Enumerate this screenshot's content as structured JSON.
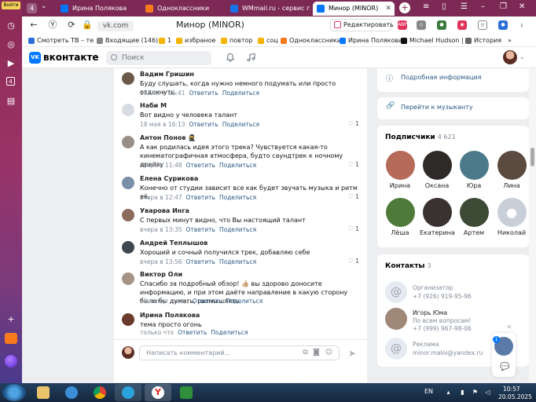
{
  "browser": {
    "login_label": "Войти",
    "tab_count": "4",
    "tabs": [
      {
        "title": "Ирина Полякова",
        "fav_color": "#0077ff"
      },
      {
        "title": "Одноклассники",
        "fav_color": "#f97a1c"
      },
      {
        "title": "WMmail.ru - сервис по",
        "fav_color": "#1a73e8"
      },
      {
        "title": "Минор (MINOR)",
        "fav_color": "#0077ff"
      }
    ],
    "url_host": "vk.com",
    "page_title": "Минор (MINOR)",
    "edit_button": "Редактировать",
    "bookmarks": [
      {
        "label": "Смотреть ТВ – те",
        "color": "#2b6fd6"
      },
      {
        "label": "Входящие (146) –",
        "color": "#888888"
      },
      {
        "label": "1",
        "color": "#f4b400"
      },
      {
        "label": "избраное",
        "color": "#f4b400"
      },
      {
        "label": "повтор",
        "color": "#f4b400"
      },
      {
        "label": "соц",
        "color": "#f4b400"
      },
      {
        "label": "Одноклассники",
        "color": "#f97a1c"
      },
      {
        "label": "Ирина Полякова",
        "color": "#0077ff"
      },
      {
        "label": "Michael Hudson |",
        "color": "#111111"
      },
      {
        "label": "История",
        "color": "#666666"
      }
    ]
  },
  "vk": {
    "logo": "вконтакте",
    "search_placeholder": "Поиск"
  },
  "comments": [
    {
      "name": "Вадим Гришин",
      "text": "Буду слушать, когда нужно немного подумать или просто отдохнуть.",
      "time": "18 мая в 12:41",
      "likes": "",
      "avatar": "#6b5a4a"
    },
    {
      "name": "Наби М",
      "text": "Вот видно у человека талант",
      "time": "18 мая в 16:13",
      "likes": "1",
      "avatar": "#d7dce2"
    },
    {
      "name": "Антон Понов 🥷",
      "text": "А как родилась идея этого трека? Чувствуется какая-то кинематографичная атмосфера, будто саундтрек к ночному драйву",
      "time": "вчера в 11:48",
      "likes": "1",
      "avatar": "#9a8f86"
    },
    {
      "name": "Елена Сурикова",
      "text": "Конечно от студии зависит все как будет звучать музыка и ритм её.",
      "time": "вчера в 12:47",
      "likes": "1",
      "avatar": "#7a8fa8"
    },
    {
      "name": "Уварова Инга",
      "text": "С первых минут видно, что Вы настоящий талант",
      "time": "вчера в 13:35",
      "likes": "1",
      "avatar": "#8c6a5c"
    },
    {
      "name": "Андрей Теплышов",
      "text": "Хороший и сочный получился трек, добавляю себе",
      "time": "вчера в 13:56",
      "likes": "1",
      "avatar": "#3e4650"
    },
    {
      "name": "Виктор Оли",
      "text": "Спасибо за подробный обзор! 👍🏼 вы здорово доносите информацию, и при этом даёте направление в какую сторону было бы думать, размышлять.",
      "time": "30 минут назад",
      "likes": "",
      "avatar": "#a59386"
    },
    {
      "name": "Ирина Полякова",
      "text": "тема просто огонь",
      "time": "только что",
      "likes": "",
      "avatar": "#6a3a2c"
    }
  ],
  "comment_actions": {
    "reply": "Ответить",
    "share": "Поделиться"
  },
  "reply_placeholder": "Написать комментарий...",
  "sidebar": {
    "more_info": "Подробная информация",
    "to_musician": "Перейти к музыканту",
    "subscribers_title": "Подписчики",
    "subscribers_count": "4 621",
    "subscribers": [
      {
        "name": "Ирина",
        "color": "#b56a5a"
      },
      {
        "name": "Оксана",
        "color": "#2e2a28"
      },
      {
        "name": "Юра",
        "color": "#4d7a8a"
      },
      {
        "name": "Лина",
        "color": "#5a4a40"
      },
      {
        "name": "Лёша",
        "color": "#4e7a3a"
      },
      {
        "name": "Екатерина",
        "color": "#3a3230"
      },
      {
        "name": "Артем",
        "color": "#3d4a36"
      },
      {
        "name": "Николай",
        "color": "#c8cfd8"
      }
    ],
    "contacts_title": "Контакты",
    "contacts_count": "3",
    "contacts": [
      {
        "role": "Организатор",
        "detail": "+7 (926) 919-95-96",
        "name": ""
      },
      {
        "name": "Игорь Юма",
        "role": "По всем вопросам!",
        "detail": "+7 (999) 967-98-06"
      },
      {
        "role": "Реклама",
        "detail": "minor.maloi@yandex.ru",
        "name": ""
      }
    ]
  },
  "floating_badge": "1",
  "taskbar": {
    "lang": "EN",
    "time": "10:57",
    "date": "20.05.2025"
  },
  "colors": {
    "vk_blue": "#0077ff",
    "link": "#2a5885",
    "muted": "#818c99"
  }
}
